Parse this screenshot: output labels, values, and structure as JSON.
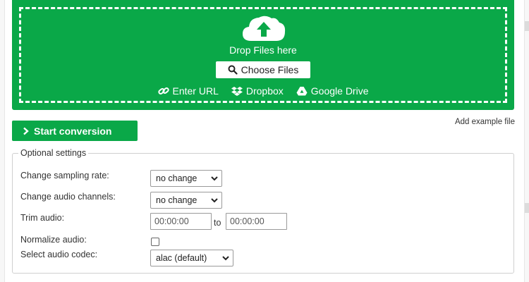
{
  "upload": {
    "drop_text": "Drop Files here",
    "choose_files_label": "Choose Files",
    "sources": [
      {
        "label": "Enter URL",
        "icon": "link-icon"
      },
      {
        "label": "Dropbox",
        "icon": "dropbox-icon"
      },
      {
        "label": "Google Drive",
        "icon": "google-drive-icon"
      }
    ]
  },
  "actions": {
    "start_conversion_label": "Start conversion",
    "add_example_label": "Add example file"
  },
  "settings": {
    "legend": "Optional settings",
    "sampling_rate": {
      "label": "Change sampling rate:",
      "value": "no change"
    },
    "audio_channels": {
      "label": "Change audio channels:",
      "value": "no change"
    },
    "trim": {
      "label": "Trim audio:",
      "start_placeholder": "00:00:00",
      "to_text": "to",
      "end_placeholder": "00:00:00"
    },
    "normalize": {
      "label": "Normalize audio:",
      "checked": false
    },
    "codec": {
      "label": "Select audio codec:",
      "value": "alac (default)"
    }
  },
  "colors": {
    "accent": "#0aa848",
    "text": "#333333",
    "border": "#cfcfcf"
  }
}
